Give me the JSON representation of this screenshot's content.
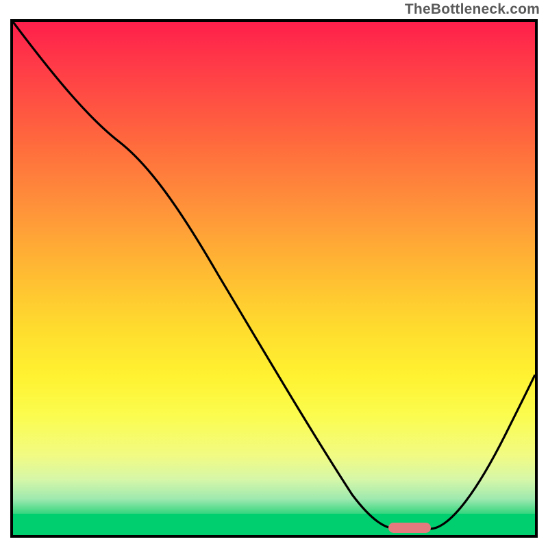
{
  "watermark": "TheBottleneck.com",
  "chart_data": {
    "type": "line",
    "title": "",
    "xlabel": "",
    "ylabel": "",
    "xlim": [
      0,
      100
    ],
    "ylim": [
      0,
      100
    ],
    "grid": false,
    "legend": false,
    "background": "gradient red-yellow-green vertical",
    "series": [
      {
        "name": "bottleneck-curve",
        "x": [
          0,
          20,
          65,
          73,
          80,
          100
        ],
        "values": [
          100,
          78,
          9,
          1,
          1,
          30
        ]
      }
    ],
    "marker": {
      "name": "optimal-range",
      "x_start": 72,
      "x_end": 80,
      "y": 1,
      "color": "#e47a7d"
    },
    "colors": {
      "frame": "#000000",
      "curve": "#000000",
      "gradient_top": "#ff1f4b",
      "gradient_mid": "#ffe030",
      "gradient_bottom": "#00cf6f",
      "marker": "#e47a7d"
    }
  }
}
